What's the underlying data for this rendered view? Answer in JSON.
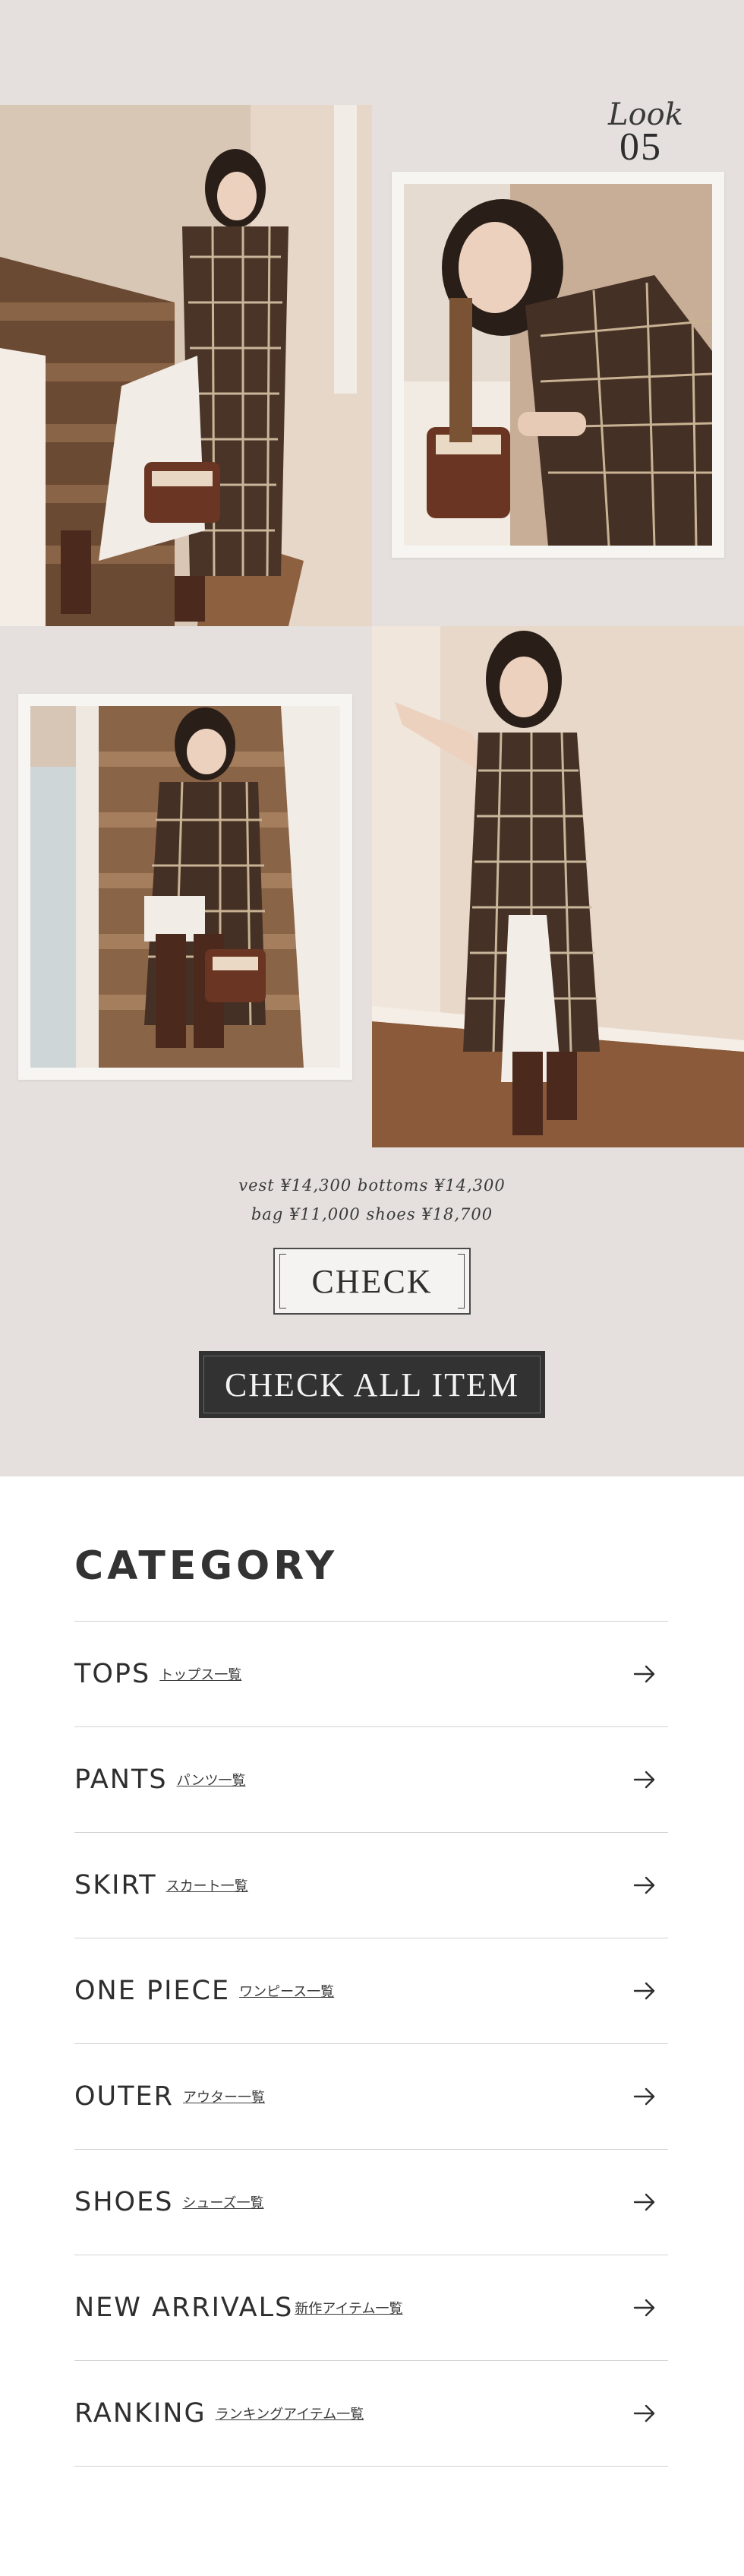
{
  "look": {
    "script": "Look",
    "number": "05",
    "credits_line1": "vest ¥14,300 bottoms ¥14,300",
    "credits_line2": "bag ¥11,000 shoes ¥18,700",
    "check_label": "CHECK",
    "check_all_label": "CHECK ALL ITEM"
  },
  "category": {
    "title": "CATEGORY",
    "items": [
      {
        "name": "TOPS",
        "sub": "トップス一覧"
      },
      {
        "name": "PANTS",
        "sub": "パンツ一覧"
      },
      {
        "name": "SKIRT",
        "sub": "スカート一覧"
      },
      {
        "name": "ONE PIECE",
        "sub": "ワンピース一覧"
      },
      {
        "name": "OUTER",
        "sub": "アウター一覧"
      },
      {
        "name": "SHOES",
        "sub": "シューズ一覧"
      },
      {
        "name": "NEW ARRIVALS",
        "sub": "新作アイテム一覧"
      },
      {
        "name": "RANKING",
        "sub": "ランキングアイテム一覧"
      }
    ]
  },
  "icons": {
    "arrow": "arrow-right-icon"
  },
  "colors": {
    "look_bg": "#e5e0dd",
    "dark_button": "#323232",
    "text": "#2e2e2e"
  }
}
